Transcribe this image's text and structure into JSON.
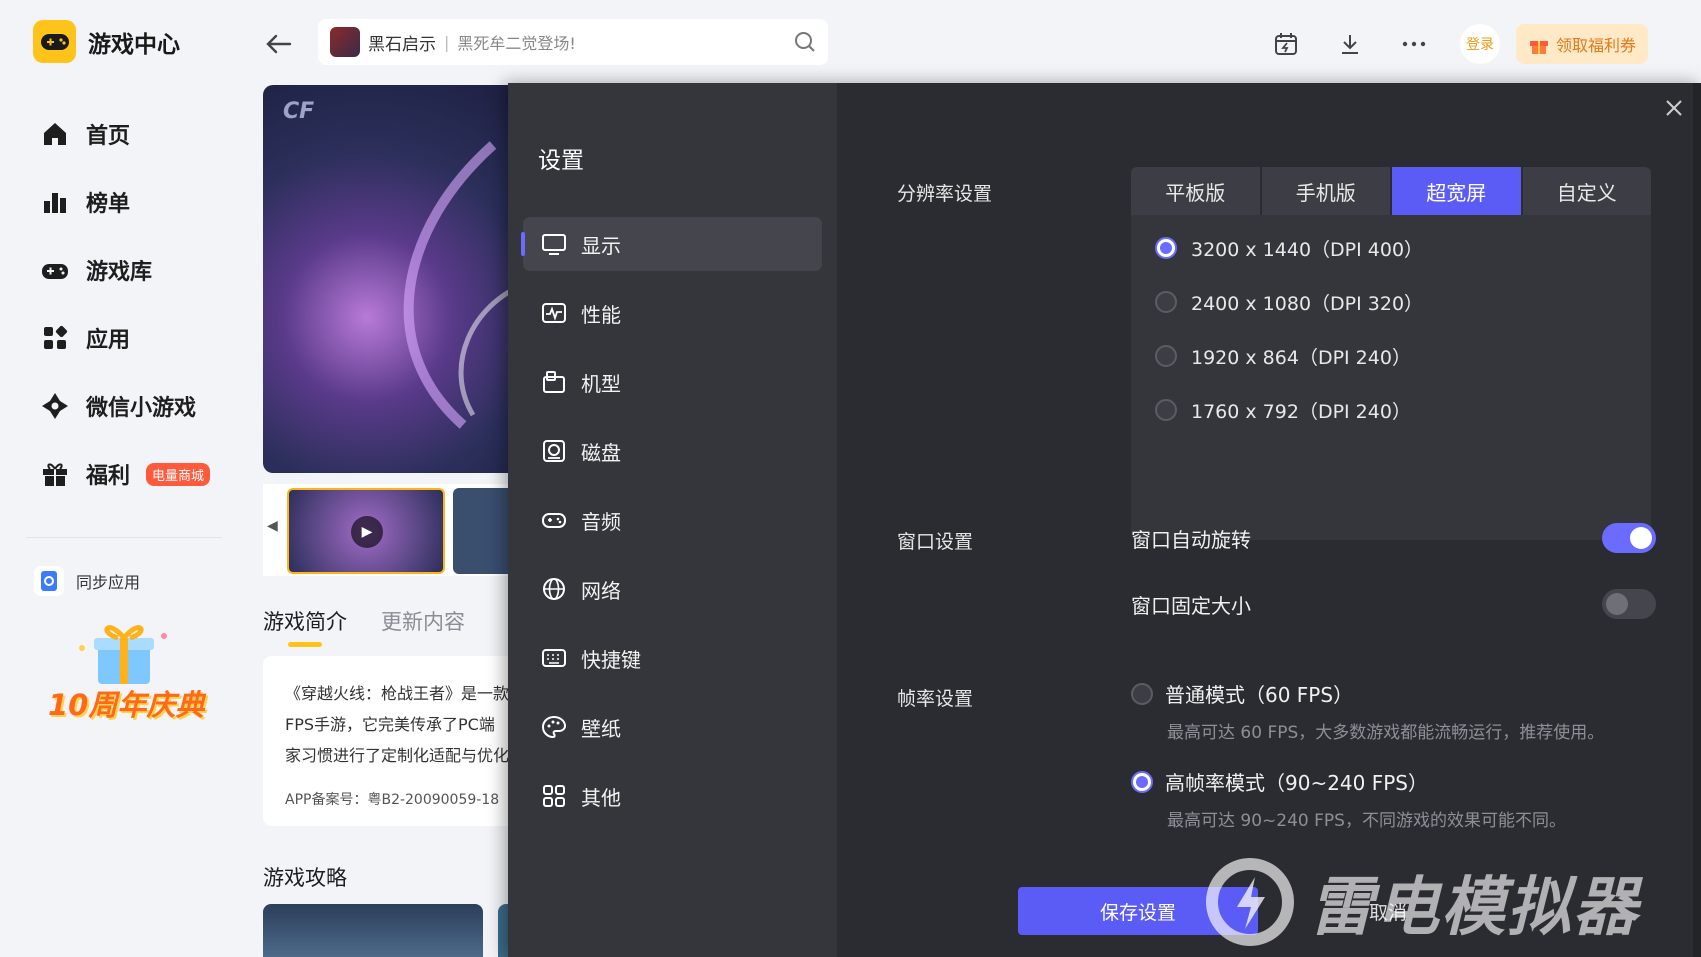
{
  "app": {
    "title": "游戏中心"
  },
  "nav": {
    "items": [
      {
        "label": "首页",
        "icon": "home-icon"
      },
      {
        "label": "榜单",
        "icon": "chart-icon"
      },
      {
        "label": "游戏库",
        "icon": "gamepad-icon"
      },
      {
        "label": "应用",
        "icon": "apps-icon"
      },
      {
        "label": "微信小游戏",
        "icon": "wechat-game-icon"
      },
      {
        "label": "福利",
        "icon": "gift-icon",
        "tag": "电量商城"
      }
    ],
    "sync_label": "同步应用",
    "banner_text": "10周年庆典"
  },
  "topbar": {
    "search_game": "黑石启示",
    "search_sep": "|",
    "search_placeholder": "黑死牟二觉登场!",
    "login_label": "登录",
    "welfare_label": "领取福利券"
  },
  "game": {
    "tab_intro": "游戏简介",
    "tab_update": "更新内容",
    "intro_lines": [
      "《穿越火线：枪战王者》是一款",
      "FPS手游，它完美传承了PC端",
      "家习惯进行了定制化适配与优化"
    ],
    "license": "APP备案号：粤B2-20090059-18",
    "guide_title": "游戏攻略"
  },
  "settings": {
    "title": "设置",
    "menu": [
      {
        "label": "显示",
        "icon": "monitor-icon",
        "active": true
      },
      {
        "label": "性能",
        "icon": "performance-icon",
        "active": false
      },
      {
        "label": "机型",
        "icon": "device-model-icon",
        "active": false
      },
      {
        "label": "磁盘",
        "icon": "disk-icon",
        "active": false
      },
      {
        "label": "音频",
        "icon": "audio-icon",
        "active": false
      },
      {
        "label": "网络",
        "icon": "globe-icon",
        "active": false
      },
      {
        "label": "快捷键",
        "icon": "keyboard-icon",
        "active": false
      },
      {
        "label": "壁纸",
        "icon": "palette-icon",
        "active": false
      },
      {
        "label": "其他",
        "icon": "grid-icon",
        "active": false
      }
    ],
    "resolution": {
      "label": "分辨率设置",
      "tabs": [
        "平板版",
        "手机版",
        "超宽屏",
        "自定义"
      ],
      "active_tab": "超宽屏",
      "options": [
        "3200 x 1440（DPI 400）",
        "2400 x 1080（DPI 320）",
        "1920 x 864（DPI 240）",
        "1760 x 792（DPI 240）"
      ],
      "selected": 0
    },
    "window": {
      "label": "窗口设置",
      "auto_rotate": {
        "label": "窗口自动旋转",
        "on": true
      },
      "fixed_size": {
        "label": "窗口固定大小",
        "on": false
      }
    },
    "fps": {
      "label": "帧率设置",
      "normal": {
        "label": "普通模式（60 FPS）",
        "desc": "最高可达 60 FPS，大多数游戏都能流畅运行，推荐使用。",
        "selected": false
      },
      "high": {
        "label": "高帧率模式（90~240 FPS）",
        "desc": "最高可达 90~240 FPS，不同游戏的效果可能不同。",
        "selected": true
      }
    },
    "save_label": "保存设置",
    "cancel_label": "取消"
  },
  "watermark": "雷电模拟器",
  "colors": {
    "accent": "#5b5bf5",
    "brand_yellow": "#ffc31a",
    "modal_bg": "#2b2c31"
  }
}
